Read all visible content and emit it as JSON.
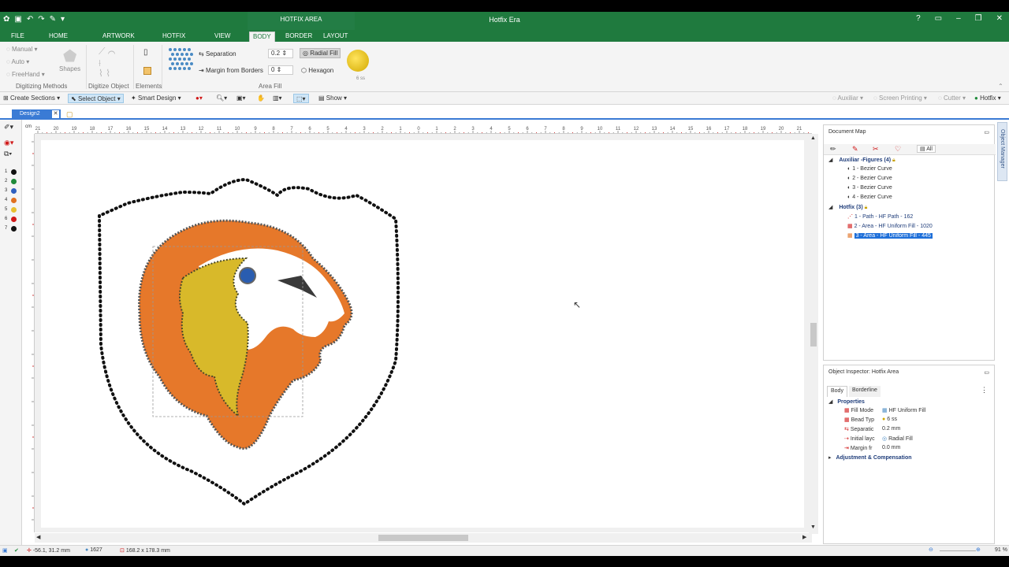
{
  "window": {
    "title": "Hotfix Era",
    "context_tab": "HOTFIX AREA"
  },
  "tabs": [
    "FILE",
    "HOME",
    "ARTWORK",
    "HOTFIX",
    "VIEW",
    "BODY",
    "BORDER",
    "LAYOUT"
  ],
  "ribbon": {
    "digitize": {
      "manual": "Manual",
      "auto": "Auto",
      "freehand": "FreeHand",
      "shapes": "Shapes",
      "group": "Digitizing Methods"
    },
    "digitize_object": "Digitize Object",
    "elements": "Elements",
    "area_fill": {
      "separation_label": "Separation",
      "separation_value": "0.2",
      "margin_label": "Margin from Borders",
      "margin_value": "0",
      "radial_fill": "Radial Fill",
      "hexagon": "Hexagon",
      "bead_size": "6 ss",
      "group": "Area Fill"
    }
  },
  "toolbar": {
    "create_sections": "Create Sections",
    "select_object": "Select Object",
    "smart_design": "Smart Design",
    "show": "Show"
  },
  "modes": [
    "Auxiliar",
    "Screen Printing",
    "Cutter",
    "Hotfix"
  ],
  "document_tab": "Design2",
  "ruler_labels": [
    "21",
    "20",
    "19",
    "18",
    "17",
    "16",
    "15",
    "14",
    "13",
    "12",
    "11",
    "10",
    "9",
    "8",
    "7",
    "6",
    "5",
    "4",
    "3",
    "2",
    "1",
    "0",
    "1",
    "2",
    "3",
    "4",
    "5",
    "6",
    "7",
    "8",
    "9",
    "10",
    "11",
    "12",
    "13",
    "14",
    "15",
    "16",
    "17",
    "18",
    "19",
    "20",
    "21"
  ],
  "palette": [
    {
      "n": "1",
      "color": "#111111"
    },
    {
      "n": "2",
      "color": "#1f8a3a"
    },
    {
      "n": "3",
      "color": "#2e5fbf"
    },
    {
      "n": "4",
      "color": "#e07020"
    },
    {
      "n": "5",
      "color": "#e8c030"
    },
    {
      "n": "6",
      "color": "#d01818"
    },
    {
      "n": "7",
      "color": "#111111"
    }
  ],
  "document_map": {
    "title": "Document Map",
    "filter": "All",
    "aux_group": "Auxiliar -Figures (4)",
    "aux_items": [
      "1 - Bezier Curve",
      "2 - Bezier Curve",
      "3 - Bezier Curve",
      "4 - Bezier Curve"
    ],
    "hotfix_group": "Hotfix (3)",
    "hotfix_items": [
      "1 - Path - HF Path - 162",
      "2 - Area - HF Uniform Fill - 1020",
      "3 - Area - HF Uniform Fill - 445"
    ]
  },
  "inspector": {
    "title": "Object Inspector: Hotfix Area",
    "tabs": [
      "Body",
      "Borderline"
    ],
    "properties_label": "Properties",
    "rows": [
      {
        "k": "Fill Mode",
        "v": "HF Uniform Fill"
      },
      {
        "k": "Bead Typ",
        "v": "6 ss"
      },
      {
        "k": "Separatic",
        "v": "0.2 mm"
      },
      {
        "k": "Initial layc",
        "v": "Radial Fill"
      },
      {
        "k": "Margin fr",
        "v": "0.0 mm"
      }
    ],
    "adjust_label": "Adjustment & Compensation"
  },
  "side_tab": "Object Manager",
  "status": {
    "coords": "-56.1, 31.2 mm",
    "count": "1627",
    "size": "168.2 x 178.3 mm",
    "zoom": "91 %"
  }
}
